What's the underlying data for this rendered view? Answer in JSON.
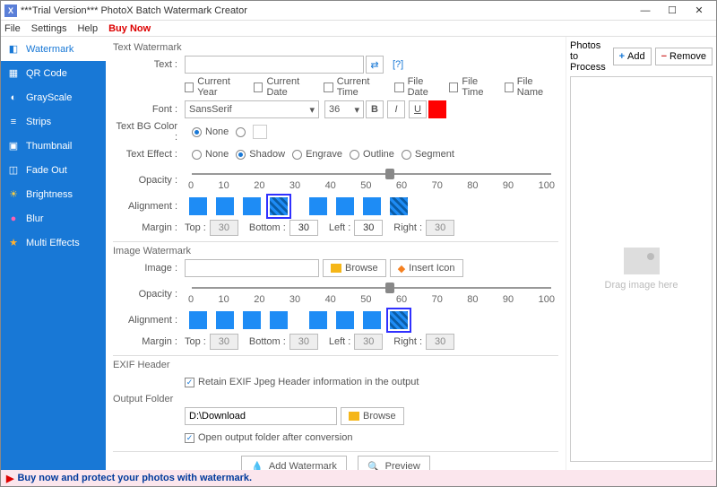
{
  "window": {
    "title": "***Trial Version*** PhotoX Batch Watermark Creator"
  },
  "menu": {
    "file": "File",
    "settings": "Settings",
    "help": "Help",
    "buy": "Buy Now"
  },
  "sidebar": {
    "items": [
      {
        "label": "Watermark"
      },
      {
        "label": "QR Code"
      },
      {
        "label": "GrayScale"
      },
      {
        "label": "Strips"
      },
      {
        "label": "Thumbnail"
      },
      {
        "label": "Fade Out"
      },
      {
        "label": "Brightness"
      },
      {
        "label": "Blur"
      },
      {
        "label": "Multi Effects"
      }
    ]
  },
  "text_wm": {
    "section": "Text Watermark",
    "text_lbl": "Text :",
    "text_val": "",
    "help": "[?]",
    "opts": {
      "cy": "Current Year",
      "cd": "Current Date",
      "ct": "Current Time",
      "fd": "File Date",
      "ft": "File Time",
      "fn": "File Name"
    },
    "font_lbl": "Font :",
    "font_val": "SansSerif",
    "font_size": "36",
    "bg_lbl": "Text BG Color :",
    "bg_none": "None",
    "eff_lbl": "Text Effect :",
    "eff": {
      "none": "None",
      "shadow": "Shadow",
      "engrave": "Engrave",
      "outline": "Outline",
      "segment": "Segment"
    },
    "opacity_lbl": "Opacity :",
    "align_lbl": "Alignment :",
    "margin_lbl": "Margin :",
    "margin": {
      "top_l": "Top :",
      "top": "30",
      "bot_l": "Bottom :",
      "bot": "30",
      "left_l": "Left :",
      "left": "30",
      "right_l": "Right :",
      "right": "30"
    }
  },
  "img_wm": {
    "section": "Image Watermark",
    "img_lbl": "Image :",
    "img_val": "",
    "browse": "Browse",
    "insert": "Insert Icon",
    "opacity_lbl": "Opacity :",
    "align_lbl": "Alignment :",
    "margin_lbl": "Margin :",
    "margin": {
      "top_l": "Top :",
      "top": "30",
      "bot_l": "Bottom :",
      "bot": "30",
      "left_l": "Left :",
      "left": "30",
      "right_l": "Right :",
      "right": "30"
    }
  },
  "slider_ticks": [
    "0",
    "10",
    "20",
    "30",
    "40",
    "50",
    "60",
    "70",
    "80",
    "90",
    "100"
  ],
  "exif": {
    "section": "EXIF Header",
    "retain": "Retain EXIF Jpeg Header information in the output"
  },
  "out": {
    "section": "Output Folder",
    "path": "D:\\Download",
    "browse": "Browse",
    "open": "Open output folder after conversion"
  },
  "actions": {
    "add": "Add Watermark",
    "preview": "Preview"
  },
  "right": {
    "title": "Photos to Process",
    "add": "Add",
    "remove": "Remove",
    "drop": "Drag image here"
  },
  "footer": {
    "msg": "Buy now and protect your photos with watermark."
  }
}
